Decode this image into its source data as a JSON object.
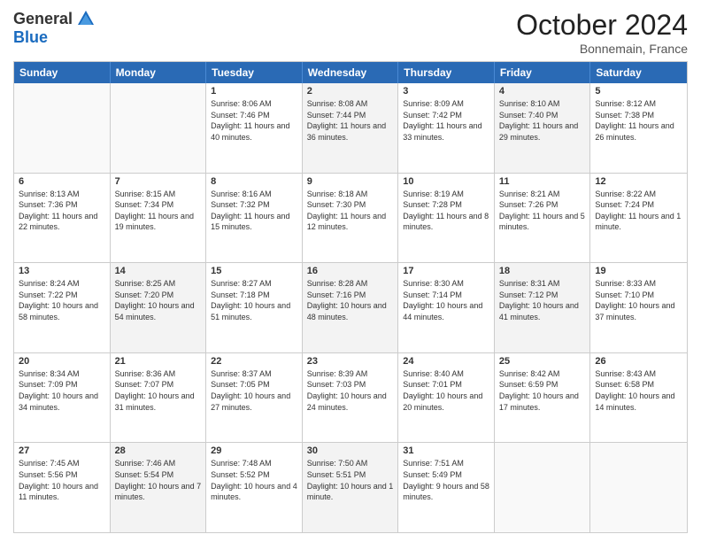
{
  "header": {
    "logo_general": "General",
    "logo_blue": "Blue",
    "month_title": "October 2024",
    "subtitle": "Bonnemain, France"
  },
  "weekdays": [
    "Sunday",
    "Monday",
    "Tuesday",
    "Wednesday",
    "Thursday",
    "Friday",
    "Saturday"
  ],
  "weeks": [
    [
      {
        "day": "",
        "sunrise": "",
        "sunset": "",
        "daylight": "",
        "empty": true
      },
      {
        "day": "",
        "sunrise": "",
        "sunset": "",
        "daylight": "",
        "empty": true
      },
      {
        "day": "1",
        "sunrise": "Sunrise: 8:06 AM",
        "sunset": "Sunset: 7:46 PM",
        "daylight": "Daylight: 11 hours and 40 minutes."
      },
      {
        "day": "2",
        "sunrise": "Sunrise: 8:08 AM",
        "sunset": "Sunset: 7:44 PM",
        "daylight": "Daylight: 11 hours and 36 minutes."
      },
      {
        "day": "3",
        "sunrise": "Sunrise: 8:09 AM",
        "sunset": "Sunset: 7:42 PM",
        "daylight": "Daylight: 11 hours and 33 minutes."
      },
      {
        "day": "4",
        "sunrise": "Sunrise: 8:10 AM",
        "sunset": "Sunset: 7:40 PM",
        "daylight": "Daylight: 11 hours and 29 minutes."
      },
      {
        "day": "5",
        "sunrise": "Sunrise: 8:12 AM",
        "sunset": "Sunset: 7:38 PM",
        "daylight": "Daylight: 11 hours and 26 minutes."
      }
    ],
    [
      {
        "day": "6",
        "sunrise": "Sunrise: 8:13 AM",
        "sunset": "Sunset: 7:36 PM",
        "daylight": "Daylight: 11 hours and 22 minutes."
      },
      {
        "day": "7",
        "sunrise": "Sunrise: 8:15 AM",
        "sunset": "Sunset: 7:34 PM",
        "daylight": "Daylight: 11 hours and 19 minutes."
      },
      {
        "day": "8",
        "sunrise": "Sunrise: 8:16 AM",
        "sunset": "Sunset: 7:32 PM",
        "daylight": "Daylight: 11 hours and 15 minutes."
      },
      {
        "day": "9",
        "sunrise": "Sunrise: 8:18 AM",
        "sunset": "Sunset: 7:30 PM",
        "daylight": "Daylight: 11 hours and 12 minutes."
      },
      {
        "day": "10",
        "sunrise": "Sunrise: 8:19 AM",
        "sunset": "Sunset: 7:28 PM",
        "daylight": "Daylight: 11 hours and 8 minutes."
      },
      {
        "day": "11",
        "sunrise": "Sunrise: 8:21 AM",
        "sunset": "Sunset: 7:26 PM",
        "daylight": "Daylight: 11 hours and 5 minutes."
      },
      {
        "day": "12",
        "sunrise": "Sunrise: 8:22 AM",
        "sunset": "Sunset: 7:24 PM",
        "daylight": "Daylight: 11 hours and 1 minute."
      }
    ],
    [
      {
        "day": "13",
        "sunrise": "Sunrise: 8:24 AM",
        "sunset": "Sunset: 7:22 PM",
        "daylight": "Daylight: 10 hours and 58 minutes."
      },
      {
        "day": "14",
        "sunrise": "Sunrise: 8:25 AM",
        "sunset": "Sunset: 7:20 PM",
        "daylight": "Daylight: 10 hours and 54 minutes."
      },
      {
        "day": "15",
        "sunrise": "Sunrise: 8:27 AM",
        "sunset": "Sunset: 7:18 PM",
        "daylight": "Daylight: 10 hours and 51 minutes."
      },
      {
        "day": "16",
        "sunrise": "Sunrise: 8:28 AM",
        "sunset": "Sunset: 7:16 PM",
        "daylight": "Daylight: 10 hours and 48 minutes."
      },
      {
        "day": "17",
        "sunrise": "Sunrise: 8:30 AM",
        "sunset": "Sunset: 7:14 PM",
        "daylight": "Daylight: 10 hours and 44 minutes."
      },
      {
        "day": "18",
        "sunrise": "Sunrise: 8:31 AM",
        "sunset": "Sunset: 7:12 PM",
        "daylight": "Daylight: 10 hours and 41 minutes."
      },
      {
        "day": "19",
        "sunrise": "Sunrise: 8:33 AM",
        "sunset": "Sunset: 7:10 PM",
        "daylight": "Daylight: 10 hours and 37 minutes."
      }
    ],
    [
      {
        "day": "20",
        "sunrise": "Sunrise: 8:34 AM",
        "sunset": "Sunset: 7:09 PM",
        "daylight": "Daylight: 10 hours and 34 minutes."
      },
      {
        "day": "21",
        "sunrise": "Sunrise: 8:36 AM",
        "sunset": "Sunset: 7:07 PM",
        "daylight": "Daylight: 10 hours and 31 minutes."
      },
      {
        "day": "22",
        "sunrise": "Sunrise: 8:37 AM",
        "sunset": "Sunset: 7:05 PM",
        "daylight": "Daylight: 10 hours and 27 minutes."
      },
      {
        "day": "23",
        "sunrise": "Sunrise: 8:39 AM",
        "sunset": "Sunset: 7:03 PM",
        "daylight": "Daylight: 10 hours and 24 minutes."
      },
      {
        "day": "24",
        "sunrise": "Sunrise: 8:40 AM",
        "sunset": "Sunset: 7:01 PM",
        "daylight": "Daylight: 10 hours and 20 minutes."
      },
      {
        "day": "25",
        "sunrise": "Sunrise: 8:42 AM",
        "sunset": "Sunset: 6:59 PM",
        "daylight": "Daylight: 10 hours and 17 minutes."
      },
      {
        "day": "26",
        "sunrise": "Sunrise: 8:43 AM",
        "sunset": "Sunset: 6:58 PM",
        "daylight": "Daylight: 10 hours and 14 minutes."
      }
    ],
    [
      {
        "day": "27",
        "sunrise": "Sunrise: 7:45 AM",
        "sunset": "Sunset: 5:56 PM",
        "daylight": "Daylight: 10 hours and 11 minutes."
      },
      {
        "day": "28",
        "sunrise": "Sunrise: 7:46 AM",
        "sunset": "Sunset: 5:54 PM",
        "daylight": "Daylight: 10 hours and 7 minutes."
      },
      {
        "day": "29",
        "sunrise": "Sunrise: 7:48 AM",
        "sunset": "Sunset: 5:52 PM",
        "daylight": "Daylight: 10 hours and 4 minutes."
      },
      {
        "day": "30",
        "sunrise": "Sunrise: 7:50 AM",
        "sunset": "Sunset: 5:51 PM",
        "daylight": "Daylight: 10 hours and 1 minute."
      },
      {
        "day": "31",
        "sunrise": "Sunrise: 7:51 AM",
        "sunset": "Sunset: 5:49 PM",
        "daylight": "Daylight: 9 hours and 58 minutes."
      },
      {
        "day": "",
        "sunrise": "",
        "sunset": "",
        "daylight": "",
        "empty": true
      },
      {
        "day": "",
        "sunrise": "",
        "sunset": "",
        "daylight": "",
        "empty": true
      }
    ]
  ]
}
